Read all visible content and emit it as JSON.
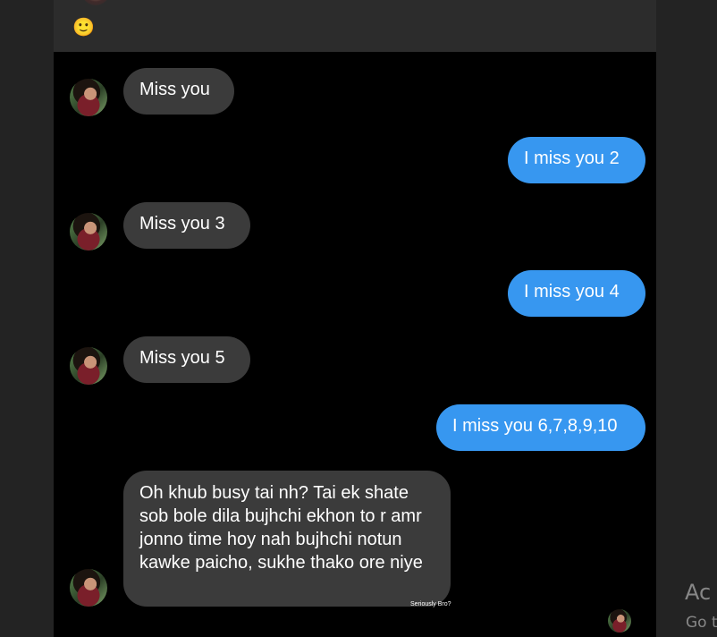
{
  "top": {
    "emoji": "🙂"
  },
  "messages": [
    {
      "side": "incoming",
      "text": "Miss you"
    },
    {
      "side": "outgoing",
      "text": "I miss you 2"
    },
    {
      "side": "incoming",
      "text": "Miss you 3"
    },
    {
      "side": "outgoing",
      "text": "I miss you 4"
    },
    {
      "side": "incoming",
      "text": "Miss you 5"
    },
    {
      "side": "outgoing",
      "text": "I miss you 6,7,8,9,10"
    },
    {
      "side": "incoming",
      "text": "Oh khub busy tai nh? Tai ek shate sob bole dila bujhchi ekhon to r amr jonno time hoy nah bujhchi notun kawke paicho, sukhe thako ore niye"
    }
  ],
  "reply_label": "Seriously Bro?",
  "watermark": {
    "title": "Ac",
    "subtitle": "Go t"
  }
}
